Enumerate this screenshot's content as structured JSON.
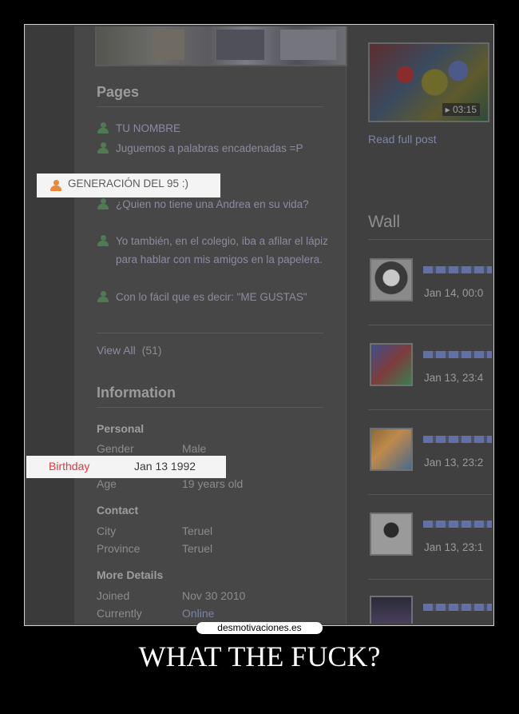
{
  "pages": {
    "title": "Pages",
    "items": [
      "TU NOMBRE",
      "Juguemos a palabras encadenadas =P",
      "GENERACIÓN DEL 95 :)",
      "¿Quien no tiene una Andrea en su vida?",
      "Yo también, en el colegio, iba a afilar el lápiz para hablar con mis amigos en la papelera.",
      "Con lo fácil que es decir: \"ME GUSTAS\""
    ],
    "view_all": "View All",
    "view_all_count": "(51)"
  },
  "information": {
    "title": "Information",
    "personal": "Personal",
    "gender_label": "Gender",
    "gender_value": "Male",
    "birthday_label": "Birthday",
    "birthday_value": "Jan 13 1992",
    "age_label": "Age",
    "age_value": "19 years old",
    "contact": "Contact",
    "city_label": "City",
    "city_value": "Teruel",
    "province_label": "Province",
    "province_value": "Teruel",
    "more_details": "More Details",
    "joined_label": "Joined",
    "joined_value": "Nov 30 2010",
    "currently_label": "Currently",
    "currently_value": "Online"
  },
  "video": {
    "duration": "03:15",
    "read_full_post": "Read full post"
  },
  "wall": {
    "title": "Wall",
    "dates": [
      "Jan 14, 00:0",
      "Jan 13, 23:4",
      "Jan 13, 23:2",
      "Jan 13, 23:1"
    ]
  },
  "watermark": "desmotivaciones.es",
  "caption": "WHAT THE FUCK?"
}
